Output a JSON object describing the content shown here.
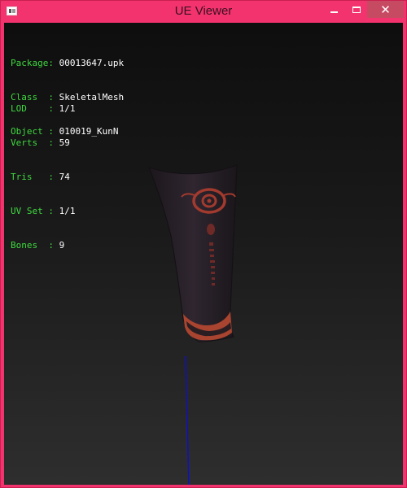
{
  "window": {
    "title": "UE Viewer",
    "close_glyph": "✕",
    "accent": "#f2336e"
  },
  "info": {
    "package": {
      "label": "Package:",
      "value": "00013647.upk"
    },
    "class": {
      "label": "Class  :",
      "value": "SkeletalMesh"
    },
    "object": {
      "label": "Object :",
      "value": "010019_KunN"
    }
  },
  "stats": {
    "lod": {
      "label": "LOD    :",
      "value": "1/1"
    },
    "verts": {
      "label": "Verts  :",
      "value": "59"
    },
    "tris": {
      "label": "Tris   :",
      "value": "74"
    },
    "uvset": {
      "label": "UV Set :",
      "value": "1/1"
    },
    "bones": {
      "label": "Bones  :",
      "value": "9"
    }
  },
  "colors": {
    "label": "#3fd83f",
    "value": "#ffffff",
    "axis": "#1010c0",
    "mesh": "#2a232a",
    "trim": "#b24a38"
  }
}
